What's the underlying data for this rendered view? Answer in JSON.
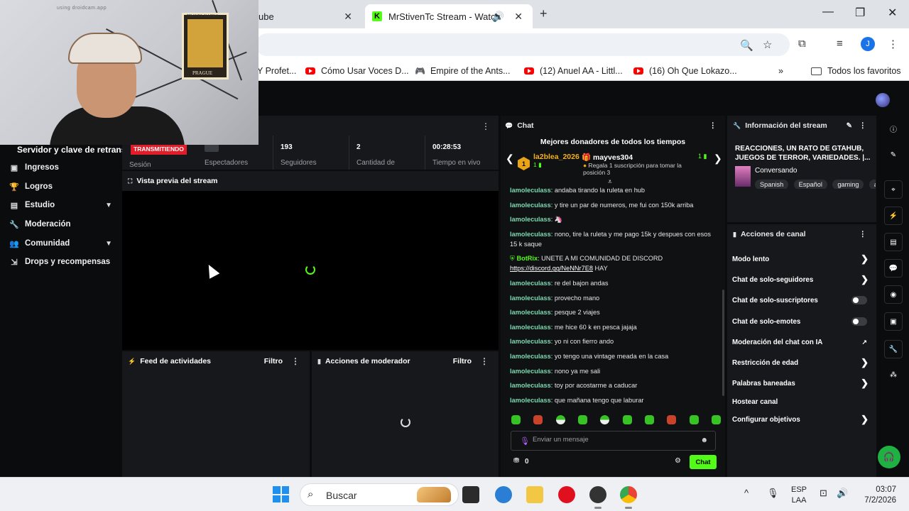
{
  "browser": {
    "tabs": [
      {
        "title": "ube",
        "active": false
      },
      {
        "title": "MrStivenTc Stream - Watch",
        "active": true
      }
    ],
    "profile_initial": "J",
    "bookmarks": [
      {
        "label": "Y Profet...",
        "icon": "youtube-icon"
      },
      {
        "label": "Cómo Usar Voces D...",
        "icon": "youtube-icon"
      },
      {
        "label": "Empire of the Ants...",
        "icon": "gamepad-icon"
      },
      {
        "label": "(12) Anuel AA - Littl...",
        "icon": "youtube-icon"
      },
      {
        "label": "(16) Oh Que Lokazo...",
        "icon": "youtube-icon"
      }
    ],
    "all_bookmarks_label": "Todos los favoritos"
  },
  "webcam": {
    "watermark": "using droidcam.app",
    "poster_text_top": "TRAVEL KAFKA",
    "poster_text_bottom": "PRAGUE"
  },
  "sidebar": {
    "heading": "Servidor y clave de retransm",
    "items": [
      {
        "label": "Ingresos",
        "icon": "wallet-icon",
        "expandable": false
      },
      {
        "label": "Logros",
        "icon": "trophy-icon",
        "expandable": false
      },
      {
        "label": "Estudio",
        "icon": "studio-icon",
        "expandable": true
      },
      {
        "label": "Moderación",
        "icon": "wrench-icon",
        "expandable": false
      },
      {
        "label": "Comunidad",
        "icon": "users-icon",
        "expandable": true
      },
      {
        "label": "Drops y recompensas",
        "icon": "gift-icon",
        "expandable": false
      }
    ]
  },
  "stats": {
    "live_badge": "TRANSMITIENDO",
    "session_label": "Sesión",
    "viewers_label": "Espectadores",
    "followers_value": "193",
    "followers_label": "Seguidores",
    "amount_value": "2",
    "amount_label": "Cantidad de",
    "uptime_value": "00:28:53",
    "uptime_label": "Tiempo en vivo"
  },
  "preview": {
    "title": "Vista previa del stream"
  },
  "activity_feed": {
    "title": "Feed de actividades",
    "filter": "Filtro"
  },
  "mod_actions": {
    "title": "Acciones de moderador",
    "filter": "Filtro"
  },
  "chat": {
    "title": "Chat",
    "donors_title": "Mejores donadores de todos los tiempos",
    "donors": [
      {
        "rank": "1",
        "name": "la2blea_2026",
        "count": "1"
      },
      {
        "name": "mayves304",
        "count": "1",
        "note": "Regala 1 suscripción para tomar la posición 3"
      }
    ],
    "messages": [
      {
        "user": "lamoleculass",
        "text": "andaba tirando la ruleta en hub"
      },
      {
        "user": "lamoleculass",
        "text": "y tire un par de numeros, me fui con 150k arriba"
      },
      {
        "user": "lamoleculass",
        "text": "🦄"
      },
      {
        "user": "lamoleculass",
        "text": "nono, tire la ruleta y me pago 15k y despues con esos 15 k saque"
      },
      {
        "user": "BotRix",
        "text": "UNETE A MI COMUNIDAD DE DISCORD",
        "link": "https://discord.gg/NeNNr7E8",
        "tail": "HAY",
        "bot": true
      },
      {
        "user": "lamoleculass",
        "text": "re del bajon andas"
      },
      {
        "user": "lamoleculass",
        "text": "provecho mano"
      },
      {
        "user": "lamoleculass",
        "text": "pesque 2 viajes"
      },
      {
        "user": "lamoleculass",
        "text": "me hice 60 k en pesca jajaja"
      },
      {
        "user": "lamoleculass",
        "text": "yo ni con fierro ando"
      },
      {
        "user": "lamoleculass",
        "text": "yo tengo una vintage meada en la casa"
      },
      {
        "user": "lamoleculass",
        "text": "nono ya me sali"
      },
      {
        "user": "lamoleculass",
        "text": "toy por acostarme a caducar"
      },
      {
        "user": "lamoleculass",
        "text": "que mañana tengo que laburar"
      }
    ],
    "input_placeholder": "Enviar un mensaje",
    "points": "0",
    "send_label": "Chat"
  },
  "stream_info": {
    "title": "Información del stream",
    "stream_title": "REACCIONES, UN RATO DE GTAHUB, JUEGOS DE TERROR, VARIEDADES. |...",
    "category": "Conversando",
    "tags": [
      "Spanish",
      "Español",
      "gaming",
      "a"
    ]
  },
  "channel_actions": {
    "title": "Acciones de canal",
    "items": [
      {
        "label": "Modo lento",
        "control": "chevron"
      },
      {
        "label": "Chat de solo-seguidores",
        "control": "chevron"
      },
      {
        "label": "Chat de solo-suscriptores",
        "control": "toggle"
      },
      {
        "label": "Chat de solo-emotes",
        "control": "toggle"
      },
      {
        "label": "Moderación del chat con IA",
        "control": "external"
      },
      {
        "label": "Restricción de edad",
        "control": "chevron"
      },
      {
        "label": "Palabras baneadas",
        "control": "chevron"
      },
      {
        "label": "Hostear canal",
        "control": "none"
      },
      {
        "label": "Configurar objetivos",
        "control": "chevron"
      }
    ]
  },
  "taskbar": {
    "search_placeholder": "Buscar",
    "lang_top": "ESP",
    "lang_bottom": "LAA",
    "time": "03:07",
    "date": "7/2/2026"
  },
  "colors": {
    "kick_green": "#53fc18",
    "live_red": "#e11d2a",
    "panel_bg": "#16181b",
    "page_bg": "#0b0c0d",
    "username": "#7cd9b0"
  }
}
